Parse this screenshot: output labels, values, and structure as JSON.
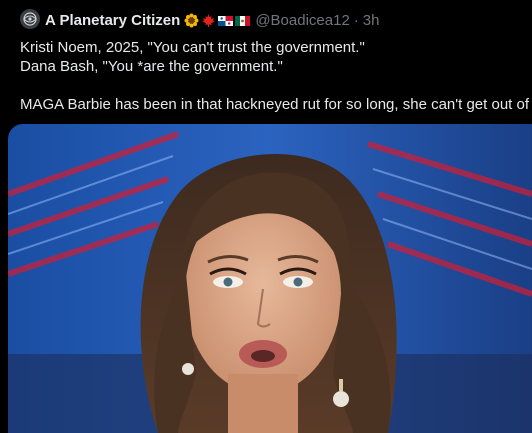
{
  "author": {
    "name": "A Planetary Citizen",
    "handle": "@Boadicea12",
    "time": "3h",
    "separator": "·",
    "badges": [
      "sunflower-emoji",
      "maple-leaf-emoji",
      "panama-flag-emoji",
      "mexico-flag-emoji"
    ]
  },
  "post": {
    "line1": "Kristi Noem, 2025, \"You can't trust the government.\"",
    "line2": "Dana Bash, \"You *are the government.\"",
    "line3": "MAGA Barbie has been in that hackneyed rut for so long, she can't get out of it."
  },
  "colors": {
    "background": "#000000",
    "text": "#e7e9ea",
    "muted": "#71767b",
    "studio_blue": "#1b4fa8",
    "studio_red": "#c8203a"
  },
  "media": {
    "subject": "news-interview-photo"
  }
}
